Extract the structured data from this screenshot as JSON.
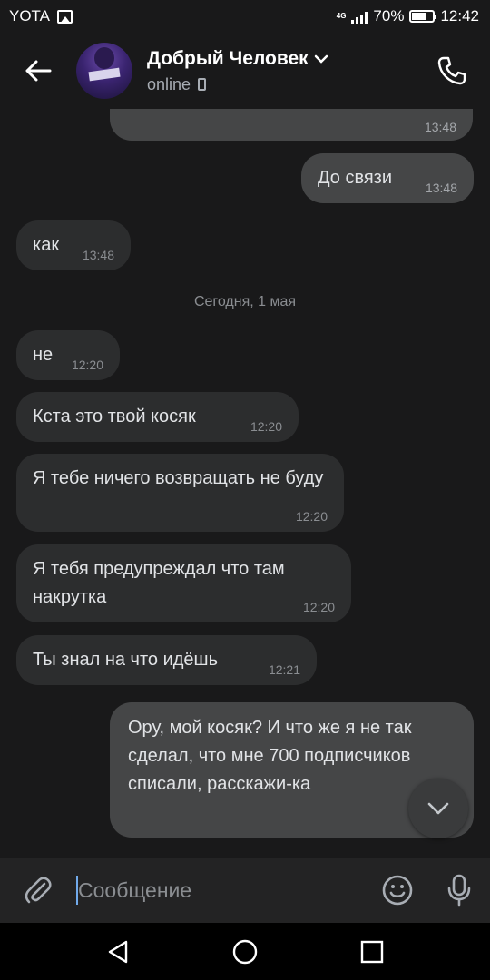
{
  "status_bar": {
    "carrier": "YOTA",
    "network": "4G",
    "battery": "70%",
    "battery_level": 0.7,
    "time": "12:42"
  },
  "header": {
    "name": "Добрый Человек",
    "status": "online"
  },
  "messages": [
    {
      "dir": "out",
      "text": "",
      "time": "13:48"
    },
    {
      "dir": "out",
      "text": "До связи",
      "time": "13:48"
    },
    {
      "dir": "in",
      "text": "как",
      "time": "13:48"
    },
    {
      "dir": "in",
      "text": "не",
      "time": "12:20"
    },
    {
      "dir": "in",
      "text": "Кста это твой косяк",
      "time": "12:20"
    },
    {
      "dir": "in",
      "text": "Я тебе ничего возвращать не буду",
      "time": "12:20"
    },
    {
      "dir": "in",
      "text": "Я тебя предупреждал что там накрутка",
      "time": "12:20"
    },
    {
      "dir": "in",
      "text": "Ты знал на что идёшь",
      "time": "12:21"
    },
    {
      "dir": "out",
      "text": "Ору, мой косяк? И что же я не так сделал, что мне 700 подписчиков списали, расскажи-ка",
      "time": ""
    }
  ],
  "date_separator": "Сегодня, 1 мая",
  "composer": {
    "placeholder": "Сообщение"
  },
  "colors": {
    "background": "#19191a",
    "incoming_bubble": "#2c2d2e",
    "outgoing_bubble": "#454647",
    "accent": "#71aaeb"
  }
}
